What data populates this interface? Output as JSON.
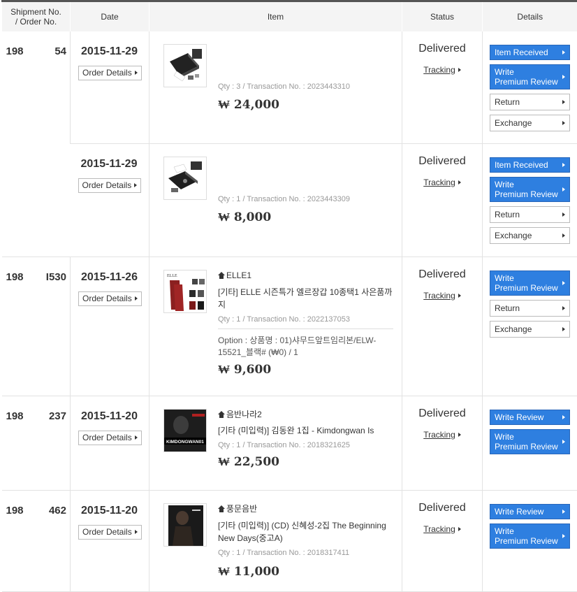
{
  "header": {
    "shipment": "Shipment No.\n/ Order No.",
    "shipment_l1": "Shipment No.",
    "shipment_l2": "/ Order No.",
    "date": "Date",
    "item": "Item",
    "status": "Status",
    "details": "Details"
  },
  "orders": [
    {
      "ship_a": "198",
      "ship_b": "54",
      "date": "2015-11-29",
      "order_details": "Order Details",
      "shop": "",
      "name": "",
      "qty": "Qty : 3 / Transaction No. : 2023443310",
      "option": "",
      "price": "₩ 24,000",
      "status": "Delivered",
      "tracking": "Tracking",
      "buttons": [
        "Item Received",
        "Write\nPremium Review",
        "Return",
        "Exchange"
      ]
    },
    {
      "ship_a": "",
      "ship_b": "",
      "date": "2015-11-29",
      "order_details": "Order Details",
      "shop": "",
      "name": "",
      "qty": "Qty : 1 / Transaction No. : 2023443309",
      "option": "",
      "price": "₩ 8,000",
      "status": "Delivered",
      "tracking": "Tracking",
      "buttons": [
        "Item Received",
        "Write\nPremium Review",
        "Return",
        "Exchange"
      ]
    },
    {
      "ship_a": "198",
      "ship_b": "I530",
      "date": "2015-11-26",
      "order_details": "Order Details",
      "shop": "ELLE1",
      "name": "[기타] ELLE 시즌특가 엘르장갑 10종택1 사은품까지",
      "qty": "Qty : 1 / Transaction No. : 2022137053",
      "option": "Option : 상품명 : 01)샤무드앞트임리본/ELW-15521_블랙# (₩0) / 1",
      "price": "₩ 9,600",
      "status": "Delivered",
      "tracking": "Tracking",
      "buttons": [
        "Write\nPremium Review",
        "Return",
        "Exchange"
      ]
    },
    {
      "ship_a": "198",
      "ship_b": "237",
      "date": "2015-11-20",
      "order_details": "Order Details",
      "shop": "음반나라2",
      "name": "[기타 (미입력)] 김동완 1집 - Kimdongwan Is",
      "qty": "Qty : 1 / Transaction No. : 2018321625",
      "option": "",
      "price": "₩ 22,500",
      "status": "Delivered",
      "tracking": "Tracking",
      "buttons": [
        "Write Review",
        "Write\nPremium Review"
      ]
    },
    {
      "ship_a": "198",
      "ship_b": "462",
      "date": "2015-11-20",
      "order_details": "Order Details",
      "shop": "풍문음반",
      "name": "[기타 (미입력)] (CD) 신혜성-2집 The Beginning New Days(중고A)",
      "qty": "Qty : 1 / Transaction No. : 2018317411",
      "option": "",
      "price": "₩ 11,000",
      "status": "Delivered",
      "tracking": "Tracking",
      "buttons": [
        "Write Review",
        "Write\nPremium Review"
      ]
    }
  ],
  "thumb_label_4": "KIMDONGWAN01",
  "thumb_label_3": "ELLE",
  "colors": {
    "accent": "#2e7fe0",
    "header_border": "#555555",
    "header_bg": "#f4f4f4"
  }
}
